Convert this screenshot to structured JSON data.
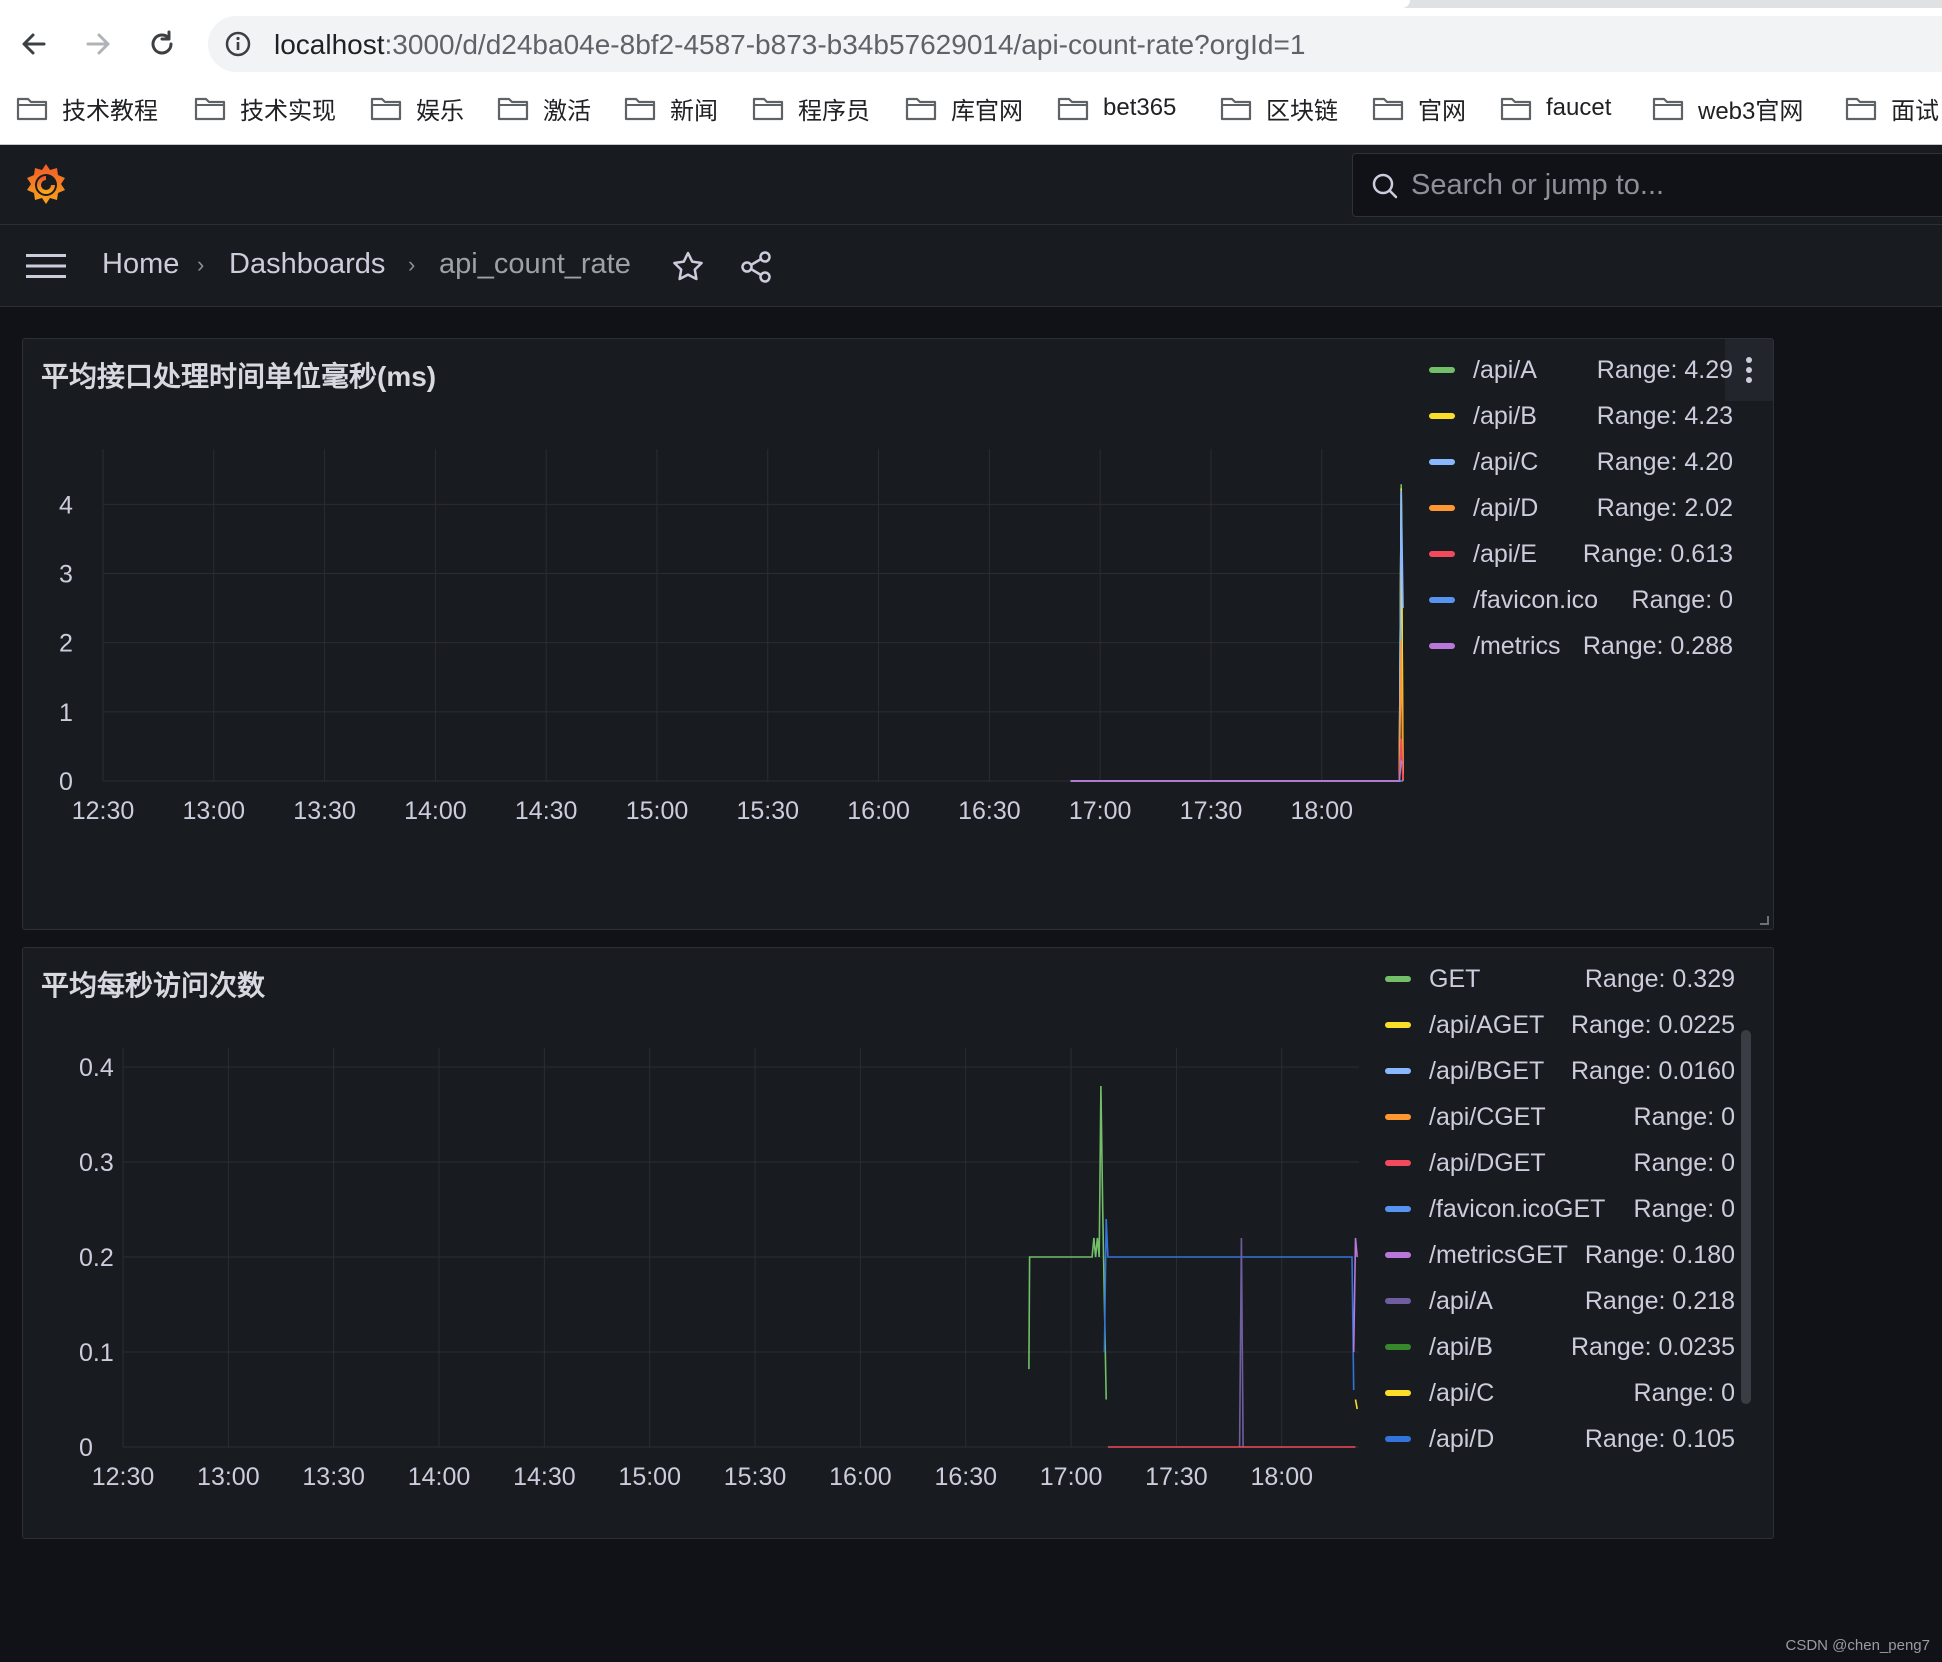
{
  "browser": {
    "url_host": "localhost",
    "url_path": ":3000/d/d24ba04e-8bf2-4587-b873-b34b57629014/api-count-rate?orgId=1",
    "bookmarks": [
      "技术教程",
      "技术实现",
      "娱乐",
      "激活",
      "新闻",
      "程序员",
      "库官网",
      "bet365",
      "区块链",
      "官网",
      "faucet",
      "web3官网",
      "面试"
    ]
  },
  "grafana": {
    "search_placeholder": "Search or jump to...",
    "breadcrumb": {
      "home": "Home",
      "dashboards": "Dashboards",
      "current": "api_count_rate"
    }
  },
  "colors": {
    "green": "#73bf69",
    "yellow": "#fade2a",
    "blue": "#8ab8ff",
    "orange": "#ff9830",
    "red": "#f2495c",
    "darkblue": "#5794f2",
    "purple": "#b877d9",
    "violet": "#705da0",
    "darkgreen": "#37872d",
    "gold": "#fade2a",
    "steel": "#3274d9"
  },
  "panels": [
    {
      "title": "平均接口处理时间单位毫秒(ms)",
      "legend": [
        {
          "name": "/api/A",
          "range": "Range: 4.29",
          "color": "#73bf69"
        },
        {
          "name": "/api/B",
          "range": "Range: 4.23",
          "color": "#fade2a"
        },
        {
          "name": "/api/C",
          "range": "Range: 4.20",
          "color": "#8ab8ff"
        },
        {
          "name": "/api/D",
          "range": "Range: 2.02",
          "color": "#ff9830"
        },
        {
          "name": "/api/E",
          "range": "Range: 0.613",
          "color": "#f2495c"
        },
        {
          "name": "/favicon.ico",
          "range": "Range: 0",
          "color": "#5794f2"
        },
        {
          "name": "/metrics",
          "range": "Range: 0.288",
          "color": "#b877d9"
        }
      ]
    },
    {
      "title": "平均每秒访问次数",
      "legend": [
        {
          "name": "GET",
          "range": "Range: 0.329",
          "color": "#73bf69"
        },
        {
          "name": "/api/AGET",
          "range": "Range: 0.0225",
          "color": "#fade2a"
        },
        {
          "name": "/api/BGET",
          "range": "Range: 0.0160",
          "color": "#8ab8ff"
        },
        {
          "name": "/api/CGET",
          "range": "Range: 0",
          "color": "#ff9830"
        },
        {
          "name": "/api/DGET",
          "range": "Range: 0",
          "color": "#f2495c"
        },
        {
          "name": "/favicon.icoGET",
          "range": "Range: 0",
          "color": "#5794f2"
        },
        {
          "name": "/metricsGET",
          "range": "Range: 0.180",
          "color": "#b877d9"
        },
        {
          "name": "/api/A",
          "range": "Range: 0.218",
          "color": "#705da0"
        },
        {
          "name": "/api/B",
          "range": "Range: 0.0235",
          "color": "#37872d"
        },
        {
          "name": "/api/C",
          "range": "Range: 0",
          "color": "#fade2a"
        },
        {
          "name": "/api/D",
          "range": "Range: 0.105",
          "color": "#3274d9"
        }
      ]
    }
  ],
  "chart_data": [
    {
      "type": "line",
      "title": "平均接口处理时间单位毫秒(ms)",
      "x_ticks": [
        "12:30",
        "13:00",
        "13:30",
        "14:00",
        "14:30",
        "15:00",
        "15:30",
        "16:00",
        "16:30",
        "17:00",
        "17:30",
        "18:00"
      ],
      "y_ticks": [
        "0",
        "1",
        "2",
        "3",
        "4"
      ],
      "xlim": [
        "12:30",
        "18:22"
      ],
      "ylim": [
        0,
        4.8
      ],
      "grid": true,
      "legend_position": "right",
      "series": [
        {
          "name": "/api/A",
          "color": "#73bf69",
          "points": [
            [
              "16:52",
              0
            ],
            [
              "18:21",
              0
            ],
            [
              "18:21.5",
              4.29
            ],
            [
              "18:22",
              0
            ]
          ]
        },
        {
          "name": "/api/B",
          "color": "#fade2a",
          "points": [
            [
              "16:52",
              0
            ],
            [
              "18:21",
              0
            ],
            [
              "18:21.5",
              4.23
            ],
            [
              "18:22",
              0.1
            ]
          ]
        },
        {
          "name": "/api/C",
          "color": "#8ab8ff",
          "points": [
            [
              "16:52",
              0
            ],
            [
              "18:21",
              0
            ],
            [
              "18:21.5",
              4.2
            ],
            [
              "18:22",
              2.5
            ]
          ]
        },
        {
          "name": "/api/D",
          "color": "#ff9830",
          "points": [
            [
              "16:52",
              0
            ],
            [
              "18:21",
              0
            ],
            [
              "18:21.5",
              2.02
            ],
            [
              "18:22",
              0
            ]
          ]
        },
        {
          "name": "/api/E",
          "color": "#f2495c",
          "points": [
            [
              "16:52",
              0
            ],
            [
              "18:21",
              0
            ],
            [
              "18:21.5",
              0.61
            ],
            [
              "18:22",
              0
            ]
          ]
        },
        {
          "name": "/favicon.ico",
          "color": "#5794f2",
          "points": [
            [
              "16:52",
              0
            ],
            [
              "18:22",
              0
            ]
          ]
        },
        {
          "name": "/metrics",
          "color": "#b877d9",
          "points": [
            [
              "16:52",
              0
            ],
            [
              "18:21",
              0
            ],
            [
              "18:21.5",
              0.288
            ],
            [
              "18:22",
              0.25
            ]
          ]
        }
      ]
    },
    {
      "type": "line",
      "title": "平均每秒访问次数",
      "x_ticks": [
        "12:30",
        "13:00",
        "13:30",
        "14:00",
        "14:30",
        "15:00",
        "15:30",
        "16:00",
        "16:30",
        "17:00",
        "17:30",
        "18:00"
      ],
      "y_ticks": [
        "0",
        "0.1",
        "0.2",
        "0.3",
        "0.4"
      ],
      "xlim": [
        "12:30",
        "18:22"
      ],
      "ylim": [
        0,
        0.42
      ],
      "grid": true,
      "legend_position": "right",
      "series": [
        {
          "name": "GET",
          "color": "#73bf69",
          "points": [
            [
              "16:48",
              0.082
            ],
            [
              "16:48.2",
              0.2
            ],
            [
              "17:06",
              0.2
            ],
            [
              "17:06.5",
              0.22
            ],
            [
              "17:07",
              0.2
            ],
            [
              "17:07.5",
              0.22
            ],
            [
              "17:08",
              0.2
            ],
            [
              "17:08.5",
              0.38
            ],
            [
              "17:09",
              0.25
            ],
            [
              "17:10",
              0.05
            ]
          ]
        },
        {
          "name": "/api/D",
          "color": "#3274d9",
          "points": [
            [
              "17:09.5",
              0.1
            ],
            [
              "17:10",
              0.24
            ],
            [
              "17:10.5",
              0.2
            ],
            [
              "18:20",
              0.2
            ],
            [
              "18:20.5",
              0.06
            ]
          ]
        },
        {
          "name": "/api/A",
          "color": "#705da0",
          "points": [
            [
              "17:48",
              0
            ],
            [
              "17:48.5",
              0.22
            ],
            [
              "17:49",
              0
            ]
          ]
        },
        {
          "name": "/metricsGET",
          "color": "#b877d9",
          "points": [
            [
              "18:20.5",
              0.1
            ],
            [
              "18:21",
              0.22
            ],
            [
              "18:21.5",
              0.2
            ]
          ]
        },
        {
          "name": "/api/DGET",
          "color": "#f2495c",
          "points": [
            [
              "17:10.5",
              0
            ],
            [
              "18:21",
              0
            ]
          ]
        },
        {
          "name": "/api/AGET",
          "color": "#fade2a",
          "points": [
            [
              "18:21",
              0.05
            ],
            [
              "18:21.5",
              0.04
            ]
          ]
        }
      ]
    }
  ],
  "watermark": "CSDN @chen_peng7"
}
